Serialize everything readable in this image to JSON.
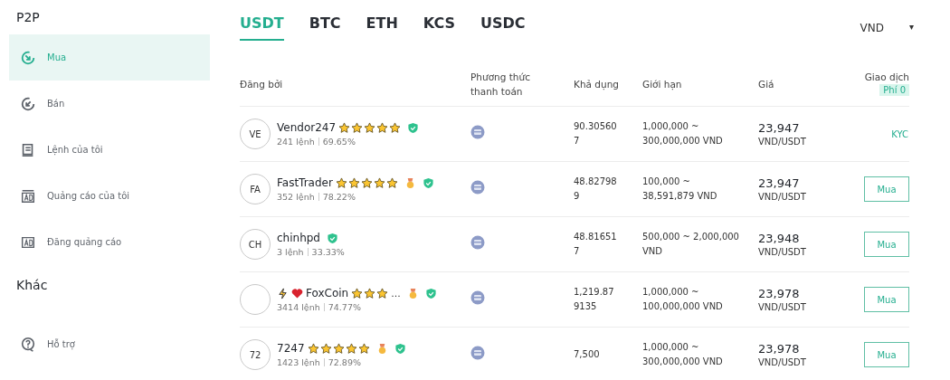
{
  "sidebar": {
    "title": "P2P",
    "items": [
      {
        "label": "Mua",
        "selected": true
      },
      {
        "label": "Bán",
        "selected": false
      },
      {
        "label": "Lệnh của tôi",
        "selected": false
      },
      {
        "label": "Quảng cáo của tôi",
        "selected": false
      },
      {
        "label": "Đăng quảng cáo",
        "selected": false
      }
    ],
    "section_title": "Khác",
    "other_items": [
      {
        "label": "Hỗ trợ",
        "selected": false
      }
    ]
  },
  "tabs": [
    {
      "label": "USDT",
      "selected": true
    },
    {
      "label": "BTC",
      "selected": false
    },
    {
      "label": "ETH",
      "selected": false
    },
    {
      "label": "KCS",
      "selected": false
    },
    {
      "label": "USDC",
      "selected": false
    }
  ],
  "currency": {
    "value": "VND",
    "caret": "▾"
  },
  "table": {
    "columns": [
      "Đăng bởi",
      "Phương thức thanh toán",
      "Khả dụng",
      "Giới hạn",
      "Giá",
      "Giao dịch"
    ],
    "fee_badge": "Phí 0",
    "rows": [
      {
        "avatar": "VE",
        "lightning": false,
        "heart": false,
        "name": "Vendor247",
        "stars": 5,
        "name_tail": "",
        "medal": false,
        "verified": true,
        "orders": "241 lệnh",
        "rate": "69.65%",
        "available": "90.305607",
        "limit": "1,000,000 ~ 300,000,000 VND",
        "price": "23,947",
        "unit": "VND/USDT",
        "action": {
          "kind": "text",
          "label": "KYC"
        }
      },
      {
        "avatar": "FA",
        "lightning": false,
        "heart": false,
        "name": "FastTrader",
        "stars": 5,
        "name_tail": "",
        "medal": true,
        "verified": true,
        "orders": "352 lệnh",
        "rate": "78.22%",
        "available": "48.827989",
        "limit": "100,000 ~ 38,591,879 VND",
        "price": "23,947",
        "unit": "VND/USDT",
        "action": {
          "kind": "button",
          "label": "Mua"
        }
      },
      {
        "avatar": "CH",
        "lightning": false,
        "heart": false,
        "name": "chinhpd",
        "name_tail": "",
        "medal": false,
        "verified": true,
        "orders": "3 lệnh",
        "rate": "33.33%",
        "available": "48.816517",
        "limit": "500,000 ~ 2,000,000 VND",
        "price": "23,948",
        "unit": "VND/USDT",
        "action": {
          "kind": "button",
          "label": "Mua"
        }
      },
      {
        "avatar": "",
        "lightning": true,
        "heart": true,
        "name": "FoxCoin",
        "stars": 3,
        "name_tail": "...",
        "medal": true,
        "verified": true,
        "orders": "3414 lệnh",
        "rate": "74.77%",
        "available": "1,219.879135",
        "limit": "1,000,000 ~ 100,000,000 VND",
        "price": "23,978",
        "unit": "VND/USDT",
        "action": {
          "kind": "button",
          "label": "Mua"
        }
      },
      {
        "avatar": "72",
        "lightning": false,
        "heart": false,
        "name": "7247",
        "stars": 5,
        "name_tail": "",
        "medal": true,
        "verified": true,
        "orders": "1423 lệnh",
        "rate": "72.89%",
        "available": "7,500",
        "limit": "1,000,000 ~ 300,000,000 VND",
        "price": "23,978",
        "unit": "VND/USDT",
        "action": {
          "kind": "button",
          "label": "Mua"
        }
      }
    ]
  }
}
